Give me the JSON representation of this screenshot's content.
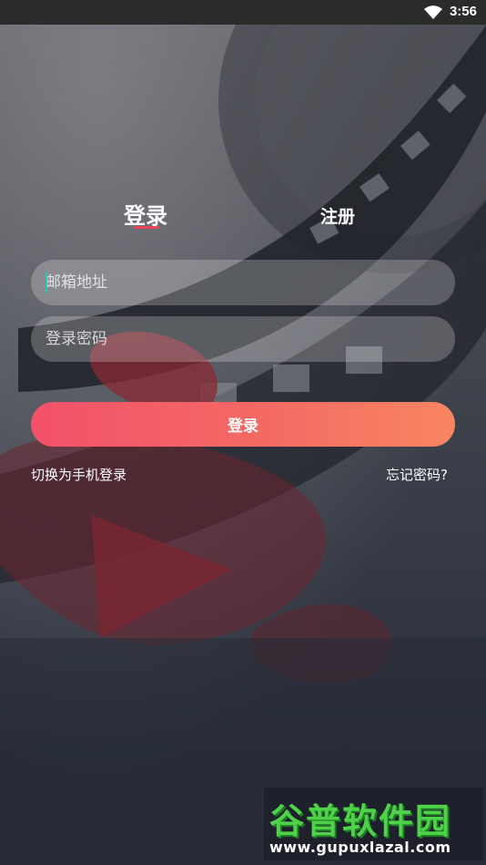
{
  "status_bar": {
    "time": "3:56"
  },
  "tabs": {
    "login": "登录",
    "register": "注册"
  },
  "form": {
    "email_placeholder": "邮箱地址",
    "password_placeholder": "登录密码",
    "submit_label": "登录"
  },
  "links": {
    "switch_phone": "切换为手机登录",
    "forgot_password": "忘记密码?"
  },
  "watermark": {
    "logo": "谷普软件园",
    "url": "www.gupuxlazal.com"
  },
  "colors": {
    "accent": "#f2516a",
    "accent_end": "#f88662",
    "tab_underline": "#e8465a",
    "caret": "#2fc4b2"
  }
}
